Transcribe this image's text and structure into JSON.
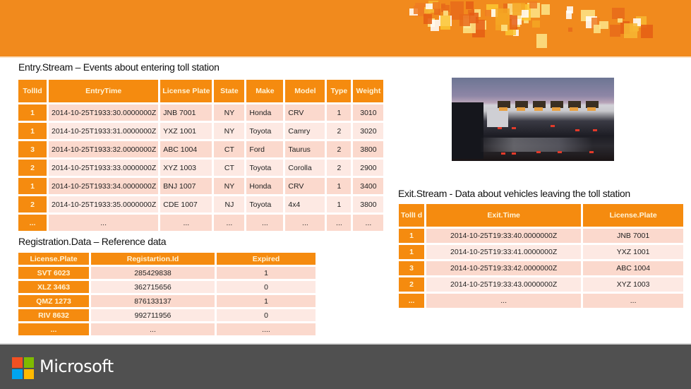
{
  "header": {
    "brand_color": "#f18a1d"
  },
  "entry_stream": {
    "title": "Entry.Stream – Events about  entering toll station",
    "columns": [
      "TollId",
      "EntryTime",
      "License Plate",
      "State",
      "Make",
      "Model",
      "Type",
      "Weight"
    ],
    "rows": [
      [
        "1",
        "2014-10-25T1933:30.0000000Z",
        "JNB 7001",
        "NY",
        "Honda",
        "CRV",
        "1",
        "3010"
      ],
      [
        "1",
        "2014-10-25T1933:31.0000000Z",
        "YXZ 1001",
        "NY",
        "Toyota",
        "Camry",
        "2",
        "3020"
      ],
      [
        "3",
        "2014-10-25T1933:32.0000000Z",
        "ABC 1004",
        "CT",
        "Ford",
        "Taurus",
        "2",
        "3800"
      ],
      [
        "2",
        "2014-10-25T1933:33.0000000Z",
        "XYZ 1003",
        "CT",
        "Toyota",
        "Corolla",
        "2",
        "2900"
      ],
      [
        "1",
        "2014-10-25T1933:34.0000000Z",
        "BNJ 1007",
        "NY",
        "Honda",
        "CRV",
        "1",
        "3400"
      ],
      [
        "2",
        "2014-10-25T1933:35.0000000Z",
        "CDE 1007",
        "NJ",
        "Toyota",
        "4x4",
        "1",
        "3800"
      ],
      [
        "...",
        "...",
        "...",
        "...",
        "...",
        "...",
        "...",
        "..."
      ]
    ]
  },
  "registration_data": {
    "title": "Registration.Data – Reference data",
    "columns": [
      "License.Plate",
      "Registartion.Id",
      "Expired"
    ],
    "rows": [
      [
        "SVT 6023",
        "285429838",
        "1"
      ],
      [
        "XLZ 3463",
        "362715656",
        "0"
      ],
      [
        "QMZ 1273",
        "876133137",
        "1"
      ],
      [
        "RIV 8632",
        "992711956",
        "0"
      ],
      [
        "...",
        "...",
        "...."
      ]
    ]
  },
  "exit_stream": {
    "title": "Exit.Stream - Data about vehicles leaving the toll station",
    "columns": [
      "TollI d",
      "Exit.Time",
      "License.Plate"
    ],
    "rows": [
      [
        "1",
        "2014-10-25T19:33:40.0000000Z",
        "JNB 7001"
      ],
      [
        "1",
        "2014-10-25T19:33:41.0000000Z",
        "YXZ 1001"
      ],
      [
        "3",
        "2014-10-25T19:33:42.0000000Z",
        "ABC 1004"
      ],
      [
        "2",
        "2014-10-25T19:33:43.0000000Z",
        "XYZ 1003"
      ],
      [
        "...",
        "...",
        "..."
      ]
    ]
  },
  "photo": {
    "description": "Cars approaching toll plaza at dusk"
  },
  "footer": {
    "brand": "Microsoft",
    "logo_colors": [
      "#f25022",
      "#7fba00",
      "#00a4ef",
      "#ffb900"
    ]
  }
}
